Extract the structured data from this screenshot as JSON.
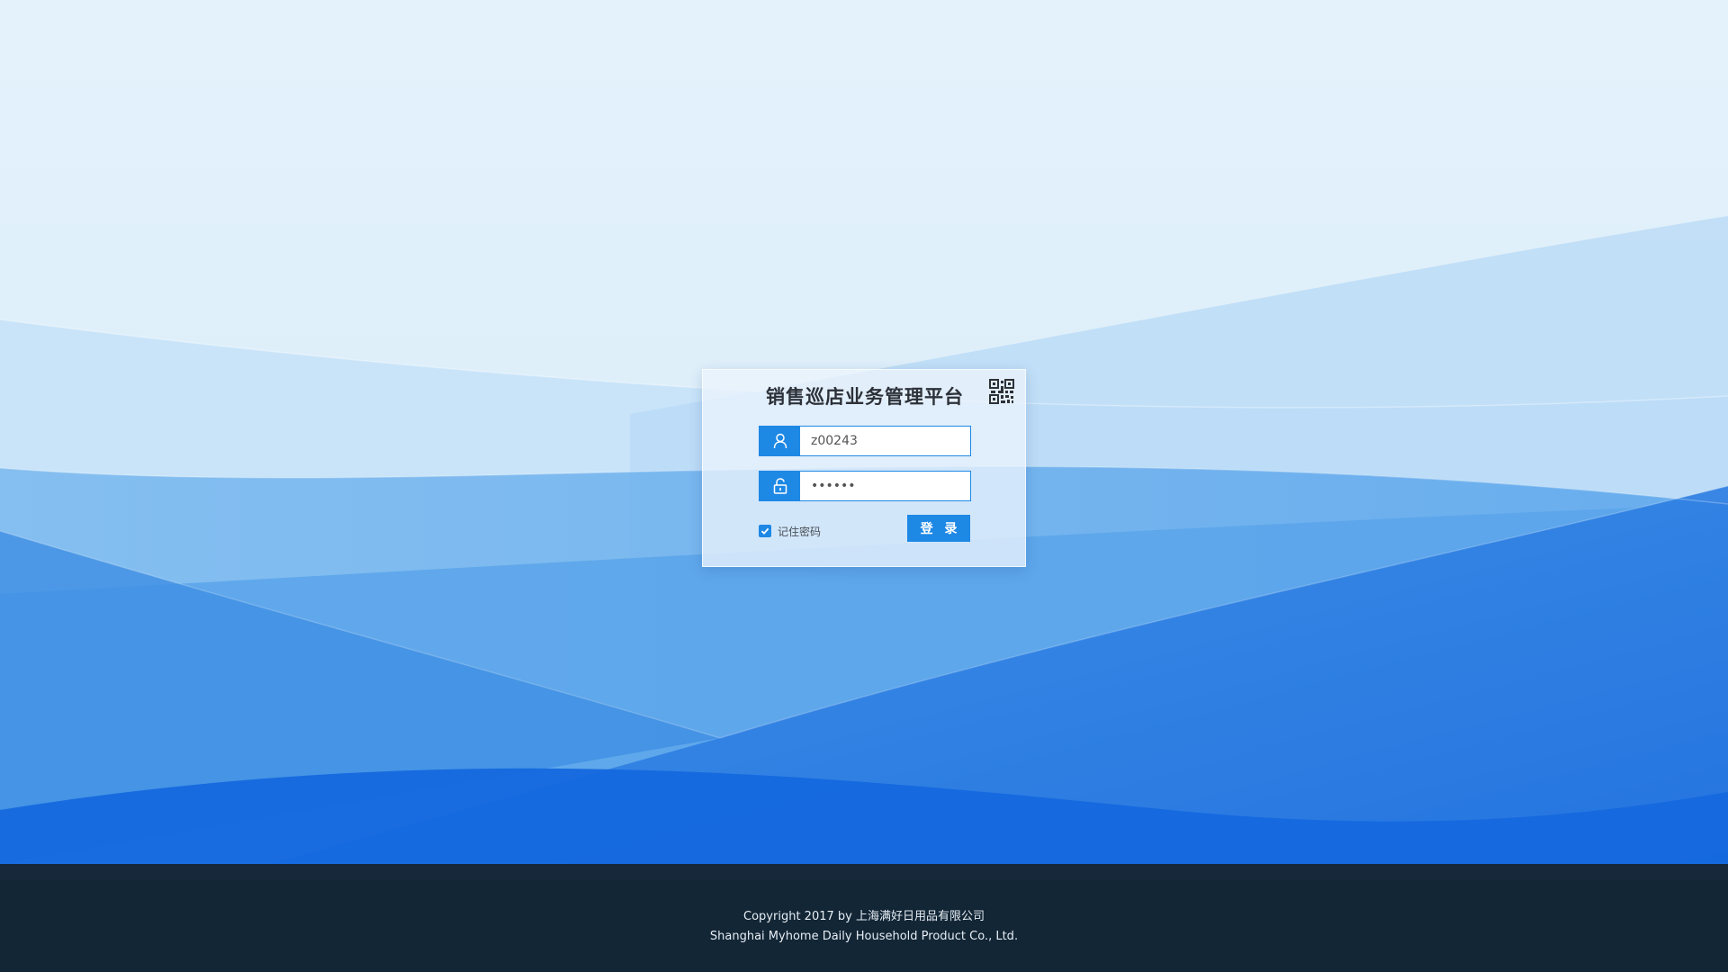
{
  "login": {
    "title": "销售巡店业务管理平台",
    "username_value": "z00243",
    "password_value": "••••••",
    "remember_label": "记住密码",
    "remember_checked": true,
    "submit_label": "登 录"
  },
  "icons": {
    "qr": "qr-code-icon",
    "user": "user-icon",
    "lock": "lock-icon",
    "check": "check-icon"
  },
  "footer": {
    "copyright": "Copyright 2017 by 上海满好日用品有限公司",
    "company_en": "Shanghai Myhome Daily Household Product Co., Ltd."
  },
  "colors": {
    "accent": "#1e88e5",
    "footer_bg": "#132636",
    "bg_top": "#e3f1fb",
    "bg_bottom": "#1465dc"
  }
}
